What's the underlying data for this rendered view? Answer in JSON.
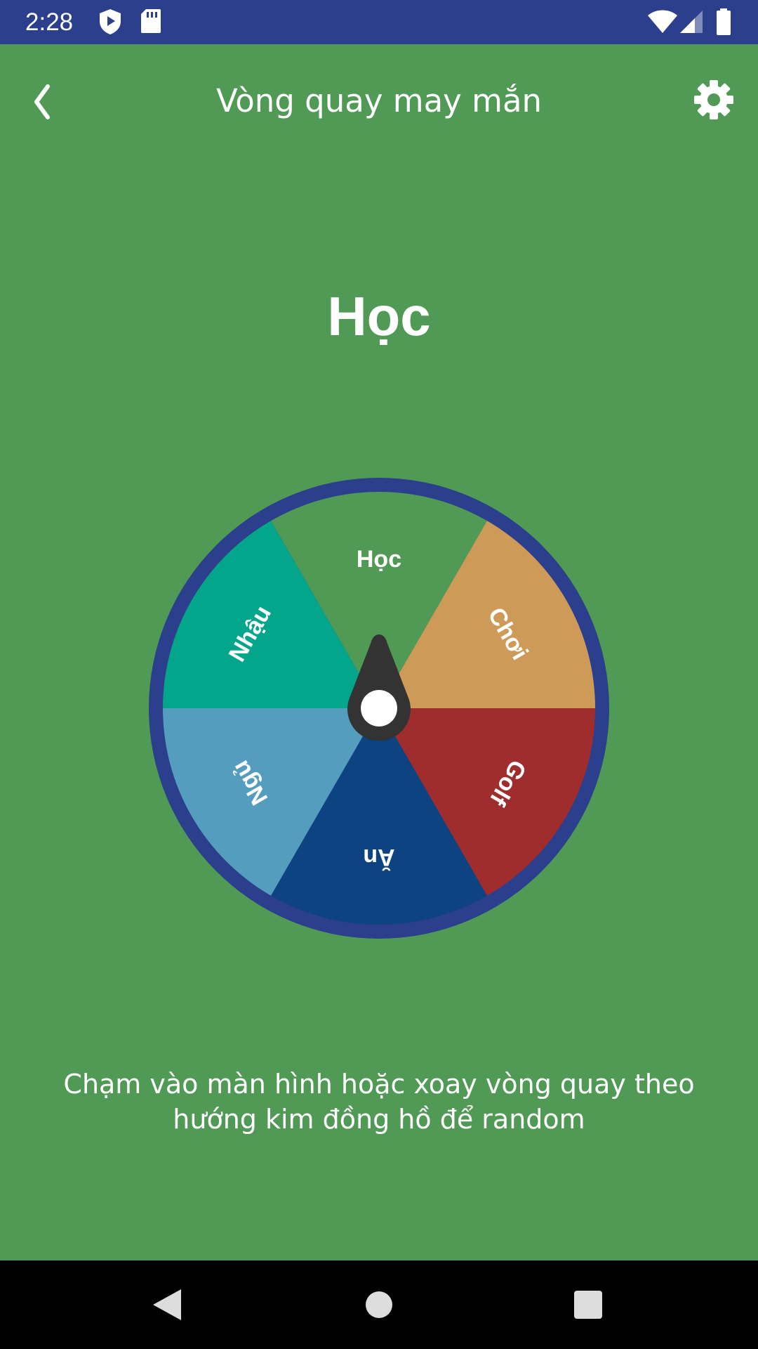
{
  "status_bar": {
    "time": "2:28",
    "icons": [
      "play-protect-icon",
      "sd-card-icon",
      "wifi-icon",
      "signal-icon",
      "battery-icon"
    ]
  },
  "app_bar": {
    "title": "Vòng quay may mắn",
    "back_icon": "chevron-left-icon",
    "settings_icon": "gear-icon"
  },
  "result": "Học",
  "wheel": {
    "rim_color": "#2b3f8c",
    "segments": [
      {
        "label": "Học",
        "color": "#509a56"
      },
      {
        "label": "Chơi",
        "color": "#cd9a58"
      },
      {
        "label": "Golf",
        "color": "#a02d2d"
      },
      {
        "label": "Ăn",
        "color": "#0c4380"
      },
      {
        "label": "Ngủ",
        "color": "#559dbe"
      },
      {
        "label": "Nhậu",
        "color": "#03a58b"
      }
    ]
  },
  "hint": {
    "line1": "Chạm vào màn hình hoặc xoay vòng quay theo",
    "line2": "hướng kim đồng hồ để random"
  },
  "nav_bar": {
    "buttons": [
      "back-triangle-icon",
      "home-circle-icon",
      "recents-square-icon"
    ]
  }
}
